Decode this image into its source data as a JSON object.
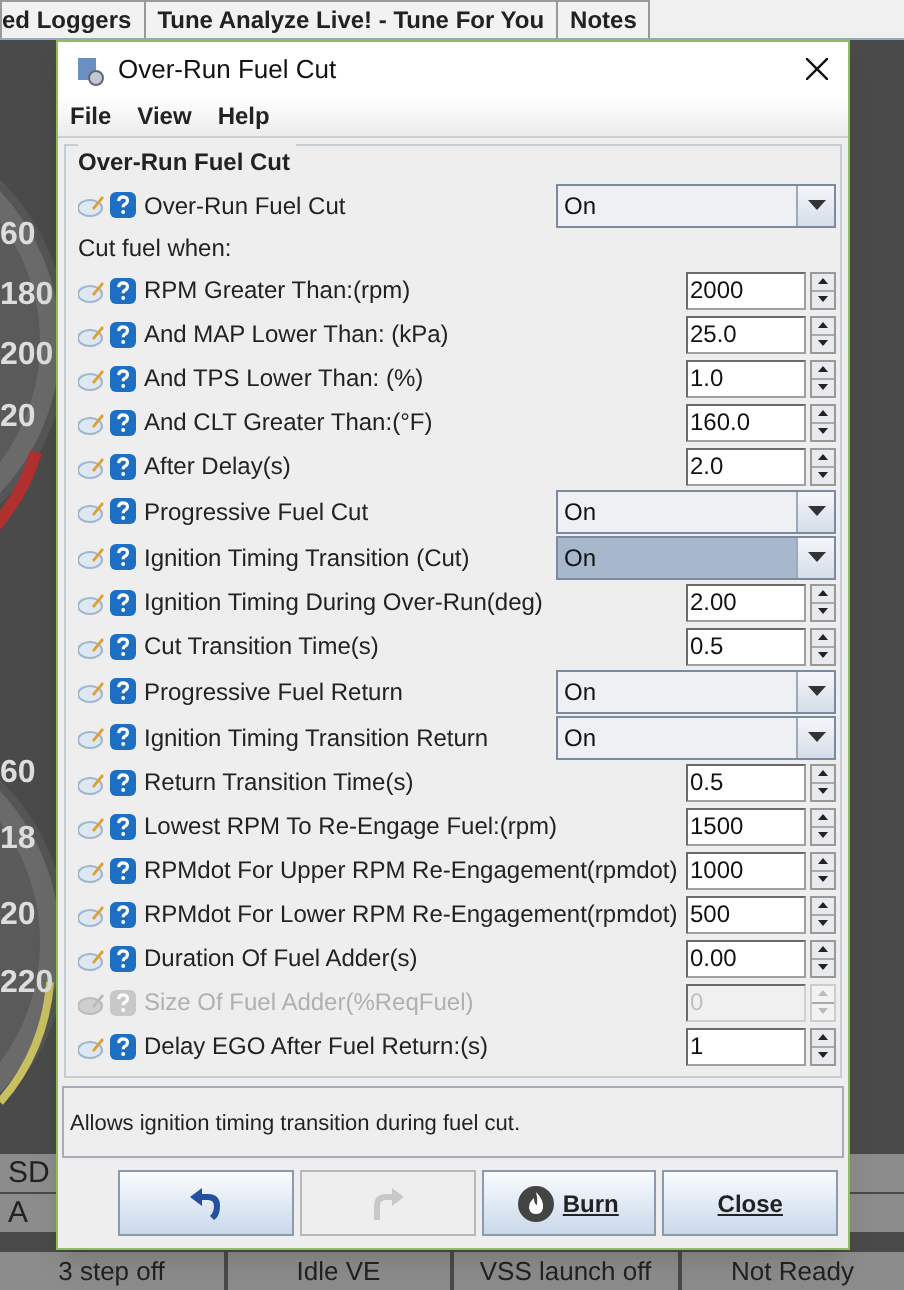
{
  "app_tabs": [
    {
      "label": "ed Loggers",
      "selected": false
    },
    {
      "label": "Tune Analyze Live! - Tune For You",
      "selected": false
    },
    {
      "label": "Notes",
      "selected": false
    }
  ],
  "gauge_labels": [
    "60",
    "180",
    "200",
    "20",
    "60",
    "18",
    "20",
    "220"
  ],
  "indicators": [
    {
      "label": "SD"
    },
    {
      "label": "A"
    }
  ],
  "indicator_row": [
    "3 step off",
    "Idle VE",
    "VSS launch off",
    "Not Ready"
  ],
  "dialog": {
    "title": "Over-Run Fuel Cut",
    "menu": [
      "File",
      "View",
      "Help"
    ],
    "group_title": "Over-Run Fuel Cut",
    "rows": [
      {
        "kind": "select",
        "label": "Over-Run Fuel Cut",
        "value": "On",
        "focused": false
      },
      {
        "kind": "label",
        "label": "Cut fuel when:"
      },
      {
        "kind": "spinner",
        "label": "RPM Greater Than:(rpm)",
        "value": "2000",
        "disabled": false
      },
      {
        "kind": "spinner",
        "label": "And MAP Lower Than:  (kPa)",
        "value": "25.0",
        "disabled": false
      },
      {
        "kind": "spinner",
        "label": "And TPS Lower Than:  (%)",
        "value": "1.0",
        "disabled": false
      },
      {
        "kind": "spinner",
        "label": "And CLT Greater Than:(°F)",
        "value": "160.0",
        "disabled": false
      },
      {
        "kind": "spinner",
        "label": "After Delay(s)",
        "value": "2.0",
        "disabled": false
      },
      {
        "kind": "select",
        "label": "Progressive Fuel Cut",
        "value": "On",
        "focused": false
      },
      {
        "kind": "select",
        "label": "Ignition Timing Transition (Cut)",
        "value": "On",
        "focused": true
      },
      {
        "kind": "spinner",
        "label": "Ignition Timing During Over-Run(deg)",
        "value": "2.00",
        "disabled": false
      },
      {
        "kind": "spinner",
        "label": "Cut Transition Time(s)",
        "value": "0.5",
        "disabled": false
      },
      {
        "kind": "select",
        "label": "Progressive Fuel Return",
        "value": "On",
        "focused": false
      },
      {
        "kind": "select",
        "label": "Ignition Timing Transition Return",
        "value": "On",
        "focused": false
      },
      {
        "kind": "spinner",
        "label": "Return Transition Time(s)",
        "value": "0.5",
        "disabled": false
      },
      {
        "kind": "spinner",
        "label": "Lowest RPM To Re-Engage Fuel:(rpm)",
        "value": "1500",
        "disabled": false
      },
      {
        "kind": "spinner",
        "label": "RPMdot For Upper RPM Re-Engagement(rpmdot)",
        "value": "1000",
        "disabled": false
      },
      {
        "kind": "spinner",
        "label": "RPMdot For Lower RPM Re-Engagement(rpmdot)",
        "value": "500",
        "disabled": false
      },
      {
        "kind": "spinner",
        "label": "Duration Of Fuel Adder(s)",
        "value": "0.00",
        "disabled": false
      },
      {
        "kind": "spinner",
        "label": "Size Of Fuel Adder(%ReqFuel)",
        "value": "0",
        "disabled": true
      },
      {
        "kind": "spinner",
        "label": "Delay EGO After Fuel Return:(s)",
        "value": "1",
        "disabled": false
      }
    ],
    "description": "Allows ignition timing transition during fuel cut.",
    "buttons": [
      {
        "kind": "undo",
        "disabled": false
      },
      {
        "kind": "redo",
        "disabled": true
      },
      {
        "kind": "burn",
        "label": "Burn",
        "disabled": false
      },
      {
        "kind": "close",
        "label": "Close",
        "disabled": false
      }
    ]
  }
}
